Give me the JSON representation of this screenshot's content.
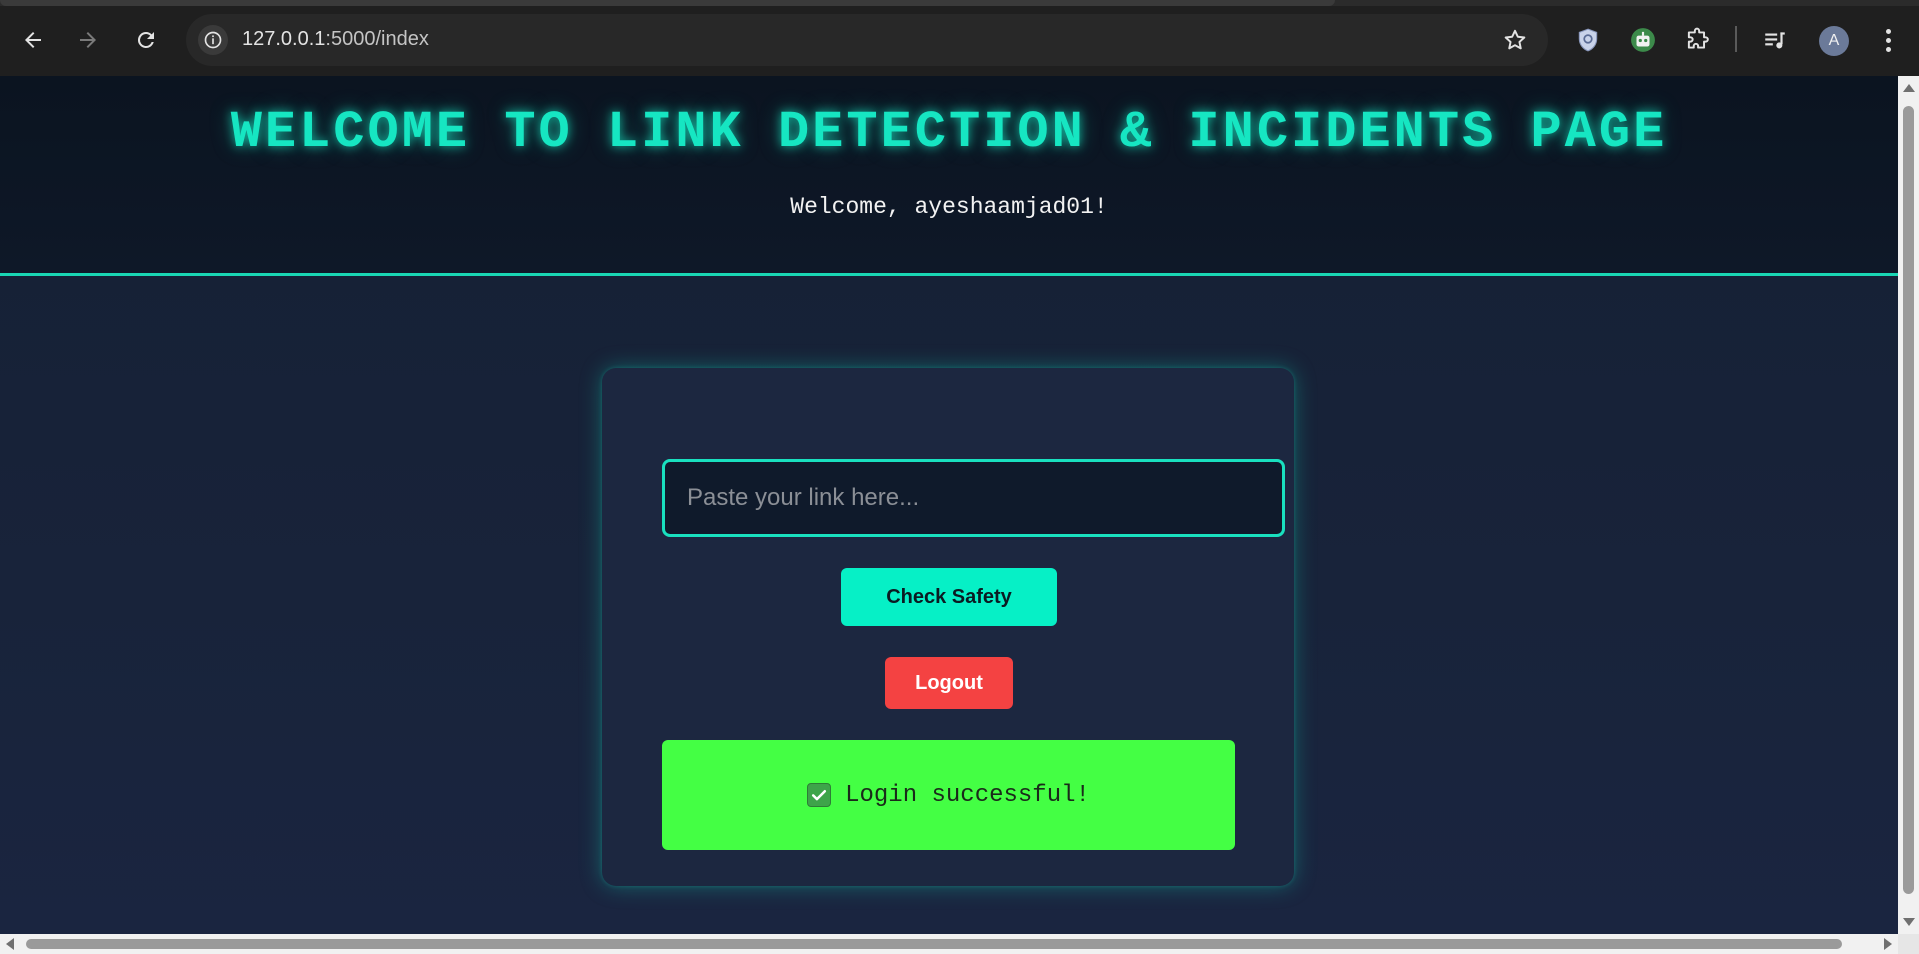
{
  "browser": {
    "url_host": "127.0.0.1",
    "url_path": ":5000/index",
    "profile_initial": "A",
    "icons": {
      "back": "arrow-left-icon",
      "forward": "arrow-right-icon",
      "reload": "reload-icon",
      "site_info": "info-icon",
      "bookmark": "star-icon",
      "extension_1": "shield-extension-icon",
      "extension_2": "robot-extension-icon",
      "extensions": "puzzle-icon",
      "media": "media-playlist-icon",
      "menu": "kebab-menu-icon"
    }
  },
  "page": {
    "title": "WELCOME TO LINK DETECTION & INCIDENTS PAGE",
    "welcome": "Welcome, ayeshaamjad01!",
    "form": {
      "link_placeholder": "Paste your link here...",
      "link_value": "",
      "check_button": "Check Safety",
      "logout_button": "Logout"
    },
    "flash": {
      "icon": "check-mark-icon",
      "message": "Login successful!"
    }
  },
  "colors": {
    "accent": "#16e6c2",
    "check_button": "#06f0c6",
    "logout_button": "#f44242",
    "success": "#44ff44",
    "card": "#1c2740",
    "background": "#152034"
  }
}
